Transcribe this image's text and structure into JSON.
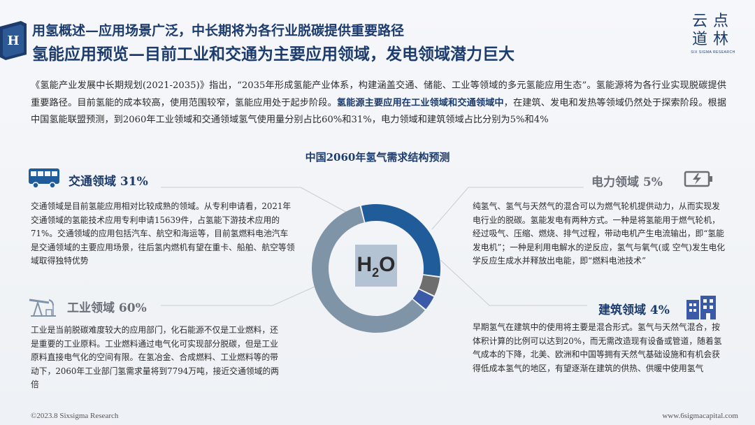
{
  "header": {
    "title_line1": "用氢概述—应用场景广泛，中长期将为各行业脱碳提供重要路径",
    "title_line2": "氢能应用预览—目前工业和交通为主要应用领域，发电领域潜力巨大",
    "logo_glyph": "H",
    "brand_line1": "云点",
    "brand_line2": "道林",
    "brand_sub": "SIX SIGMA RESEARCH"
  },
  "intro": {
    "part1": "《氢能产业发展中长期规划(2021-2035)》指出，“2035年形成氢能产业体系，构建涵盖交通、储能、工业等领域的多元氢能应用生态”。氢能源将为各行业实现脱碳提供重要路径。目前氢能的成本较高，使用范围较窄，氢能应用处于起步阶段。",
    "highlight": "氢能源主要应用在工业领域和交通领域中",
    "part2": "，在建筑、发电和发热等领域仍然处于探索阶段。根据中国氢能联盟预测，到2060年工业领域和交通领域氢气使用量分别占比60%和31%，电力领域和建筑领域占比分别为5%和4%"
  },
  "chart_title": "中国2060年氢气需求结构预测",
  "center_label": "H2O",
  "sections": {
    "transport": {
      "title": "交通领域 31%",
      "text": "交通领域是目前氢能应用相对比较成熟的领域。从专利申请看，2021年交通领域的氢能技术应用专利申请15639件，占氢能下游技术应用的71%。交通领域的应用包括汽车、航空和海运等，目前氢燃料电池汽车是交通领域的主要应用场景，往后氢内燃机有望在重卡、船舶、航空等领域取得独特优势"
    },
    "industry": {
      "title": "工业领域 60%",
      "text": "工业是当前脱碳难度较大的应用部门，化石能源不仅是工业燃料，还是重要的工业原料。工业燃料通过电气化可实现部分脱碳，但是工业原料直接电气化的空间有限。在氢冶金、合成燃料、工业燃料等的带动下，2060年工业部门氢需求量将到7794万吨，接近交通领域的两倍"
    },
    "power": {
      "title": "电力领域 5%",
      "text": "纯氢气、氢气与天然气的混合可以为燃气轮机提供动力，从而实现发电行业的脱碳。氢能发电有两种方式。一种是将氢能用于燃气轮机，经过吸气、压缩、燃烧、排气过程，带动电机产生电流输出，即“氢能发电机”；一种是利用电解水的逆反应，氢气与氧气(或 空气)发生电化学反应生成水并释放出电能，即“燃料电池技术”"
    },
    "building": {
      "title": "建筑领域 4%",
      "text": "早期氢气在建筑中的使用将主要是混合形式。氢气与天然气混合，按体积计算的比例可以达到20%，而无需改造现有设备或管道，随着氢气成本的下降，北美、欧洲和中国等拥有天然气基础设施和有机会获得低成本氢气的地区，有望逐渐在建筑的供热、供暖中使用氢气"
    }
  },
  "footer": {
    "left": "©2023.8 Sixsigma Research",
    "right": "www.6sigmacapital.com"
  },
  "colors": {
    "navy": "#1d3c6e",
    "transport_blue": "#1f5c99",
    "industry_gray": "#8094a8",
    "power_dark": "#6e6e6e",
    "building_blue": "#3a5aa8"
  },
  "chart_data": {
    "type": "pie",
    "title": "中国2060年氢气需求结构预测",
    "categories": [
      "交通领域",
      "电力领域",
      "建筑领域",
      "工业领域"
    ],
    "values": [
      31,
      5,
      4,
      60
    ]
  }
}
